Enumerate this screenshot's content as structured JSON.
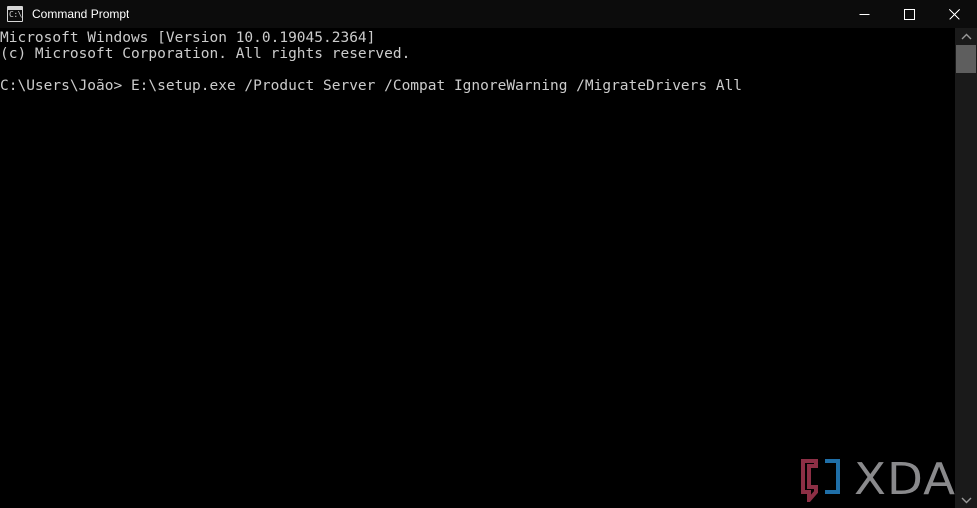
{
  "window": {
    "title": "Command Prompt",
    "app_icon": "console-icon",
    "icon_glyph": "C:\\_",
    "background_color": "#000000",
    "titlebar_color": "#0c0c0c"
  },
  "titlebar_controls": [
    {
      "name": "minimize-button",
      "icon": "minimize-icon",
      "label": "Minimize"
    },
    {
      "name": "maximize-button",
      "icon": "maximize-icon",
      "label": "Maximize"
    },
    {
      "name": "close-button",
      "icon": "close-icon",
      "label": "Close"
    }
  ],
  "console": {
    "text_color": "#cccccc",
    "lines": [
      "Microsoft Windows [Version 10.0.19045.2364]",
      "(c) Microsoft Corporation. All rights reserved.",
      "",
      "C:\\Users\\João> E:\\setup.exe /Product Server /Compat IgnoreWarning /MigrateDrivers All"
    ],
    "content": "Microsoft Windows [Version 10.0.19045.2364]\n(c) Microsoft Corporation. All rights reserved.\n\nC:\\Users\\João> E:\\setup.exe /Product Server /Compat IgnoreWarning /MigrateDrivers All",
    "prompt": "C:\\Users\\João>",
    "command": "E:\\setup.exe /Product Server /Compat IgnoreWarning /MigrateDrivers All",
    "os_version": "10.0.19045.2364",
    "copyright": "(c) Microsoft Corporation. All rights reserved."
  },
  "scrollbar": {
    "up_arrow": "chevron-up-icon",
    "down_arrow": "chevron-down-icon",
    "thumb_color": "#5e5e5e",
    "track_color": "#1a1a1a"
  },
  "watermark": {
    "text": "XDA",
    "text_color": "#8a8a8c",
    "bracket_left_color": "#8c2f45",
    "bracket_right_color": "#1f6fa8"
  }
}
